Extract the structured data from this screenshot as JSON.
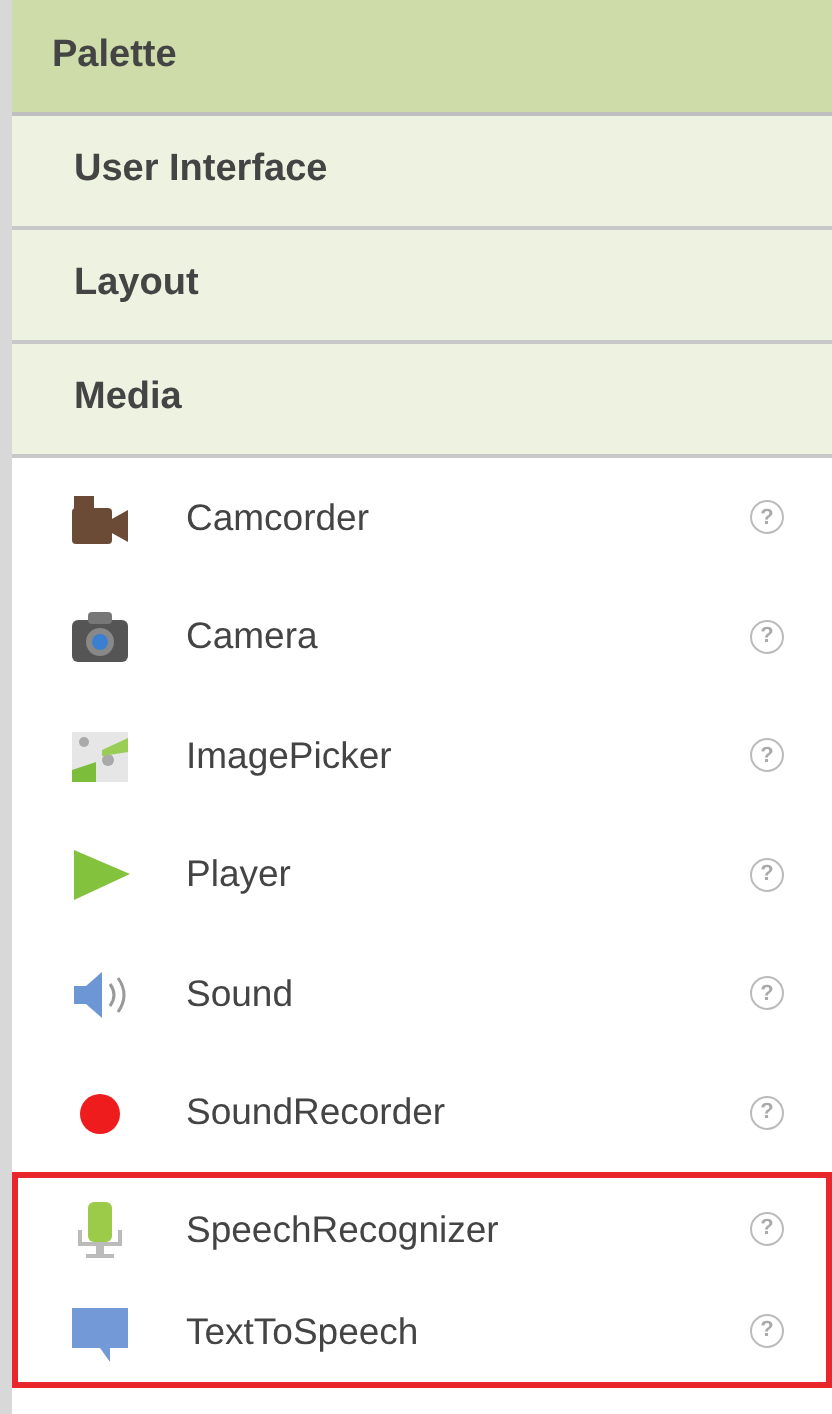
{
  "palette": {
    "title": "Palette"
  },
  "categories": [
    {
      "label": "User Interface"
    },
    {
      "label": "Layout"
    },
    {
      "label": "Media"
    }
  ],
  "components": [
    {
      "name": "Camcorder",
      "kind": "camcorder",
      "help": "?",
      "highlighted": false
    },
    {
      "name": "Camera",
      "kind": "camera",
      "help": "?",
      "highlighted": false
    },
    {
      "name": "ImagePicker",
      "kind": "imagepicker",
      "help": "?",
      "highlighted": false
    },
    {
      "name": "Player",
      "kind": "player",
      "help": "?",
      "highlighted": false
    },
    {
      "name": "Sound",
      "kind": "sound",
      "help": "?",
      "highlighted": false
    },
    {
      "name": "SoundRecorder",
      "kind": "recorder",
      "help": "?",
      "highlighted": false
    },
    {
      "name": "SpeechRecognizer",
      "kind": "microphone",
      "help": "?",
      "highlighted": true
    },
    {
      "name": "TextToSpeech",
      "kind": "speech",
      "help": "?",
      "highlighted": true
    }
  ]
}
